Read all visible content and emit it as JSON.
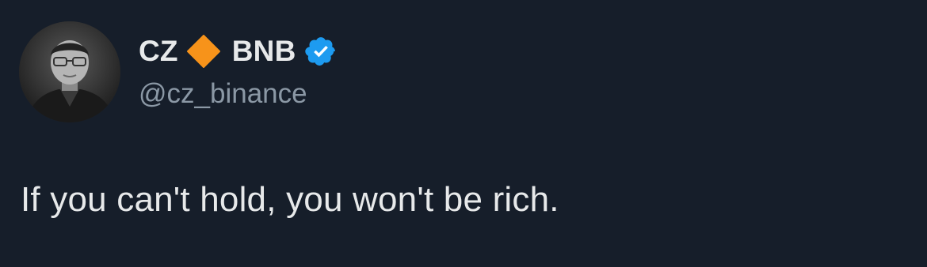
{
  "author": {
    "name_part1": "CZ",
    "name_part2": "BNB",
    "handle": "@cz_binance",
    "name_icon": "orange-diamond-icon",
    "badge_icon": "blue-verified-check-icon",
    "avatar": "black-and-white-profile-photo"
  },
  "tweet": {
    "text": "If you can't hold, you won't be rich."
  },
  "colors": {
    "background": "#161e2a",
    "text_primary": "#e7e9ea",
    "text_secondary": "#8b98a5",
    "diamond": "#f7931a",
    "verified": "#1d9bf0"
  }
}
